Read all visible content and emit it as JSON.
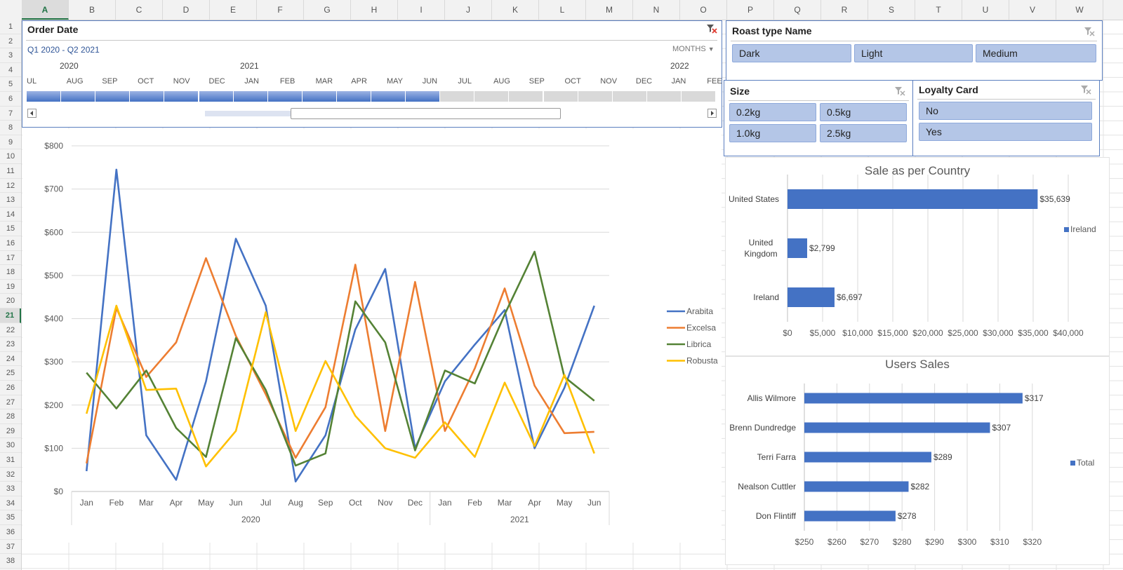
{
  "spreadsheet": {
    "columns": [
      "A",
      "B",
      "C",
      "D",
      "E",
      "F",
      "G",
      "H",
      "I",
      "J",
      "K",
      "L",
      "M",
      "N",
      "O",
      "P",
      "Q",
      "R",
      "S",
      "T",
      "U",
      "V",
      "W"
    ],
    "selected_column": "A",
    "rows": [
      "1",
      "2",
      "3",
      "4",
      "5",
      "6",
      "7",
      "8",
      "9",
      "10",
      "11",
      "12",
      "13",
      "14",
      "15",
      "16",
      "17",
      "18",
      "19",
      "20",
      "21",
      "22",
      "23",
      "24",
      "25",
      "26",
      "27",
      "28",
      "29",
      "30",
      "31",
      "32",
      "33",
      "34",
      "35",
      "36",
      "37",
      "38"
    ],
    "selected_row": "21"
  },
  "timeline": {
    "title": "Order Date",
    "range_label": "Q1 2020 - Q2 2021",
    "period_selector": "MONTHS",
    "years": [
      "2020",
      "2021",
      "2022"
    ],
    "months": [
      "UL",
      "AUG",
      "SEP",
      "OCT",
      "NOV",
      "DEC",
      "JAN",
      "FEB",
      "MAR",
      "APR",
      "MAY",
      "JUN",
      "JUL",
      "AUG",
      "SEP",
      "OCT",
      "NOV",
      "DEC",
      "JAN",
      "FEE"
    ],
    "selected_months": 12
  },
  "slicers": {
    "roast": {
      "title": "Roast type Name",
      "items": [
        "Dark",
        "Light",
        "Medium"
      ]
    },
    "size": {
      "title": "Size",
      "items": [
        "0.2kg",
        "0.5kg",
        "1.0kg",
        "2.5kg"
      ]
    },
    "loyalty": {
      "title": "Loyalty Card",
      "items": [
        "No",
        "Yes"
      ]
    }
  },
  "colors": {
    "accent": "#4472c4",
    "slicer_fill": "#b4c6e7",
    "arabita": "#4472c4",
    "excelsa": "#ed7d31",
    "librica": "#548235",
    "robusta": "#ffc000"
  },
  "chart_data": [
    {
      "type": "line",
      "title": "",
      "categories": [
        "Jan",
        "Feb",
        "Mar",
        "Apr",
        "May",
        "Jun",
        "Jul",
        "Aug",
        "Sep",
        "Oct",
        "Nov",
        "Dec",
        "Jan",
        "Feb",
        "Mar",
        "Apr",
        "May",
        "Jun"
      ],
      "groups": [
        {
          "label": "2020",
          "count": 12
        },
        {
          "label": "2021",
          "count": 6
        }
      ],
      "series": [
        {
          "name": "Arabita",
          "color": "#4472c4",
          "values": [
            47,
            745,
            130,
            27,
            255,
            585,
            430,
            23,
            130,
            375,
            515,
            100,
            255,
            340,
            420,
            100,
            240,
            430
          ]
        },
        {
          "name": "Excelsa",
          "color": "#ed7d31",
          "values": [
            65,
            425,
            265,
            345,
            540,
            360,
            225,
            78,
            195,
            525,
            140,
            485,
            140,
            285,
            470,
            245,
            135,
            138
          ]
        },
        {
          "name": "Librica",
          "color": "#548235",
          "values": [
            275,
            192,
            280,
            147,
            80,
            355,
            235,
            60,
            88,
            440,
            345,
            95,
            280,
            250,
            410,
            555,
            265,
            210
          ]
        },
        {
          "name": "Robusta",
          "color": "#ffc000",
          "values": [
            180,
            430,
            235,
            238,
            58,
            140,
            415,
            140,
            302,
            175,
            100,
            78,
            160,
            80,
            252,
            105,
            270,
            88
          ]
        }
      ],
      "y_ticks": [
        "$0",
        "$100",
        "$200",
        "$300",
        "$400",
        "$500",
        "$600",
        "$700",
        "$800"
      ],
      "ylim": [
        0,
        800
      ],
      "grid": true,
      "legend_position": "right"
    },
    {
      "type": "bar",
      "orientation": "horizontal",
      "title": "Sale as per Country",
      "categories": [
        "United States",
        "United Kingdom",
        "Ireland"
      ],
      "values": [
        35639,
        2799,
        6697
      ],
      "value_labels": [
        "$35,639",
        "$2,799",
        "$6,697"
      ],
      "x_ticks": [
        "$0",
        "$5,000",
        "$10,000",
        "$15,000",
        "$20,000",
        "$25,000",
        "$30,000",
        "$35,000",
        "$40,000"
      ],
      "xlim": [
        0,
        40000
      ],
      "legend": [
        "Ireland"
      ],
      "legend_position": "right",
      "grid": true
    },
    {
      "type": "bar",
      "orientation": "horizontal",
      "title": "Users Sales",
      "categories": [
        "Allis Wilmore",
        "Brenn Dundredge",
        "Terri Farra",
        "Nealson Cuttler",
        "Don Flintiff"
      ],
      "values": [
        317,
        307,
        289,
        282,
        278
      ],
      "value_labels": [
        "$317",
        "$307",
        "$289",
        "$282",
        "$278"
      ],
      "x_ticks": [
        "$250",
        "$260",
        "$270",
        "$280",
        "$290",
        "$300",
        "$310",
        "$320"
      ],
      "xlim": [
        250,
        325
      ],
      "legend": [
        "Total"
      ],
      "legend_position": "right",
      "grid": true
    }
  ]
}
